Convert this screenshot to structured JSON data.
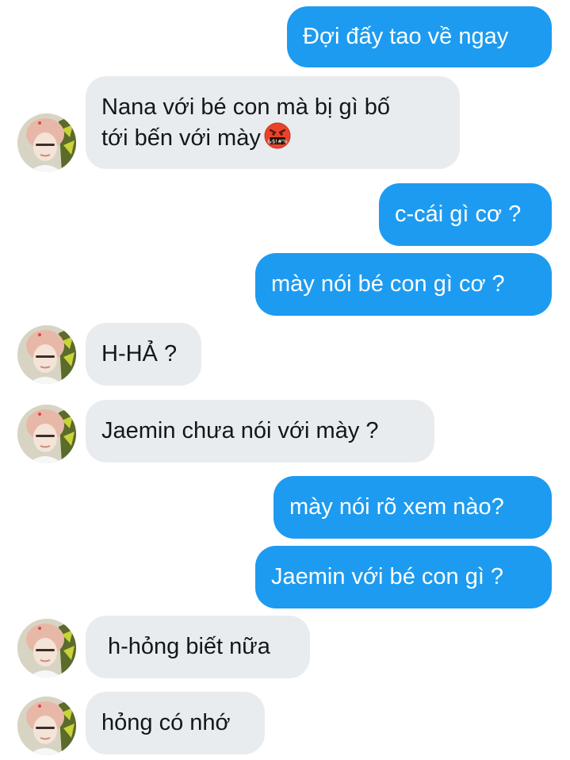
{
  "conversation": {
    "colors": {
      "outgoing": "#1d9bf0",
      "incoming": "#e9ecef",
      "incoming_text": "#14171a"
    },
    "messages": [
      {
        "side": "outgoing",
        "text": "Đợi đấy tao về ngay"
      },
      {
        "side": "incoming",
        "line1": "Nana với bé con mà bị gì bố",
        "line2": "tới bến với mày",
        "emoji": "angry-swearing-face"
      },
      {
        "side": "outgoing",
        "text": "c-cái gì cơ ?"
      },
      {
        "side": "outgoing",
        "text": "mày nói bé con gì cơ ?"
      },
      {
        "side": "incoming",
        "text": "H-HẢ ?"
      },
      {
        "side": "incoming",
        "text": "Jaemin chưa nói với mày ?"
      },
      {
        "side": "outgoing",
        "text": "mày nói rõ xem nào?"
      },
      {
        "side": "outgoing",
        "text": "Jaemin với bé con gì ?"
      },
      {
        "side": "incoming",
        "text": "h-hỏng biết nữa"
      },
      {
        "side": "incoming",
        "text": "hỏng có nhớ"
      }
    ]
  }
}
